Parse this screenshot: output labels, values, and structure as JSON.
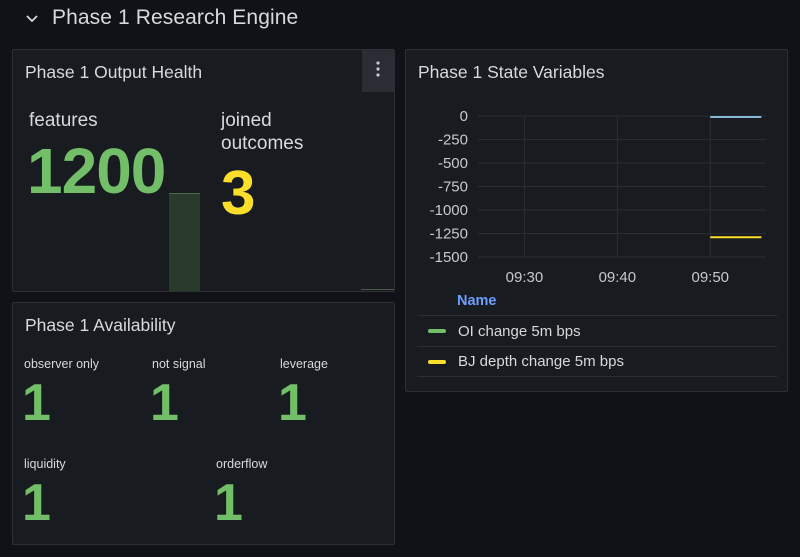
{
  "row": {
    "title": "Phase 1 Research Engine"
  },
  "health": {
    "title": "Phase 1 Output Health",
    "features_label": "features",
    "features_value": "1200",
    "joined_label_line1": "joined",
    "joined_label_line2": "outcomes",
    "joined_value": "3",
    "colors": {
      "green": "#73bf69",
      "yellow": "#fade2a"
    }
  },
  "availability": {
    "title": "Phase 1 Availability",
    "items": [
      {
        "label": "observer only",
        "value": "1"
      },
      {
        "label": "not signal",
        "value": "1"
      },
      {
        "label": "leverage",
        "value": "1"
      },
      {
        "label": "liquidity",
        "value": "1"
      },
      {
        "label": "orderflow",
        "value": "1"
      }
    ]
  },
  "state": {
    "title": "Phase 1 State Variables",
    "legend_header": "Name",
    "chart_data": {
      "type": "line",
      "yticks": [
        0,
        -250,
        -500,
        -750,
        -1000,
        -1250,
        -1500
      ],
      "ytick_labels": [
        "0",
        "-250",
        "-500",
        "-750",
        "-1000",
        "-1250",
        "-1500"
      ],
      "xtick_labels": [
        "09:30",
        "09:40",
        "09:50"
      ],
      "ylim": [
        -1500,
        0
      ],
      "x_range_minutes": [
        9.5,
        25.7
      ],
      "xticks_minutes": [
        14.5,
        24.5,
        34.5
      ],
      "series": [
        {
          "name": "OI change 5m bps",
          "color": "#73bf69",
          "x": [
            34.5,
            40
          ],
          "values": [
            -10,
            -10
          ],
          "display_color": "#8ab8d9"
        },
        {
          "name": "BJ depth change 5m bps",
          "color": "#fade2a",
          "x": [
            34.5,
            40
          ],
          "values": [
            -1290,
            -1290
          ],
          "display_color": "#fade2a"
        }
      ]
    }
  }
}
